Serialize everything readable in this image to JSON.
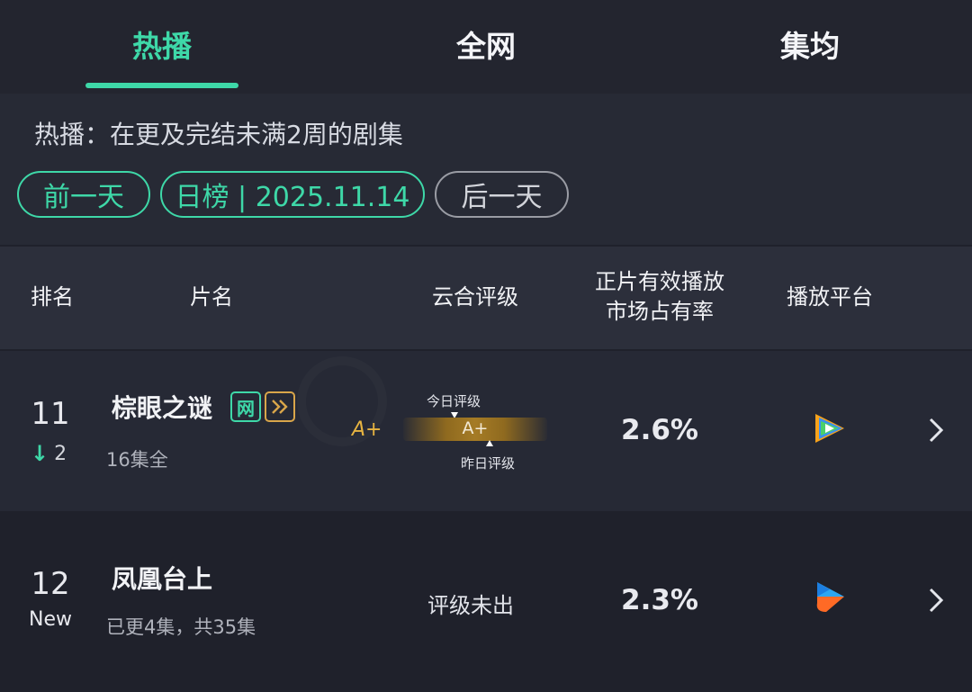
{
  "tabs": [
    {
      "label": "热播",
      "active": true
    },
    {
      "label": "全网",
      "active": false
    },
    {
      "label": "集均",
      "active": false
    }
  ],
  "description": "热播：在更及完结未满2周的剧集",
  "date_nav": {
    "prev": "前一天",
    "current": "日榜 | 2025.11.14",
    "next": "后一天"
  },
  "table": {
    "headers": {
      "rank": "排名",
      "name": "片名",
      "rating": "云合评级",
      "share_line1": "正片有效播放",
      "share_line2": "市场占有率",
      "platform": "播放平台"
    },
    "rows": [
      {
        "rank": "11",
        "change": "2",
        "change_direction": "down",
        "title": "棕眼之谜",
        "badge_net": "网",
        "badge_play_icon": "double-chevron-icon",
        "episodes": "16集全",
        "grade": "A+",
        "gauge_grade": "A+",
        "today_label": "今日评级",
        "yesterday_label": "昨日评级",
        "share": "2.6%",
        "platform_icon": "tencent-video-icon"
      },
      {
        "rank": "12",
        "status": "New",
        "title": "凤凰台上",
        "episodes": "已更4集，共35集",
        "rating_text": "评级未出",
        "share": "2.3%",
        "platform_icon": "youku-icon"
      }
    ]
  },
  "colors": {
    "accent": "#3ed8a8",
    "gold": "#e7b441",
    "background": "#1f212b",
    "header_bg": "#2c2f3b"
  }
}
